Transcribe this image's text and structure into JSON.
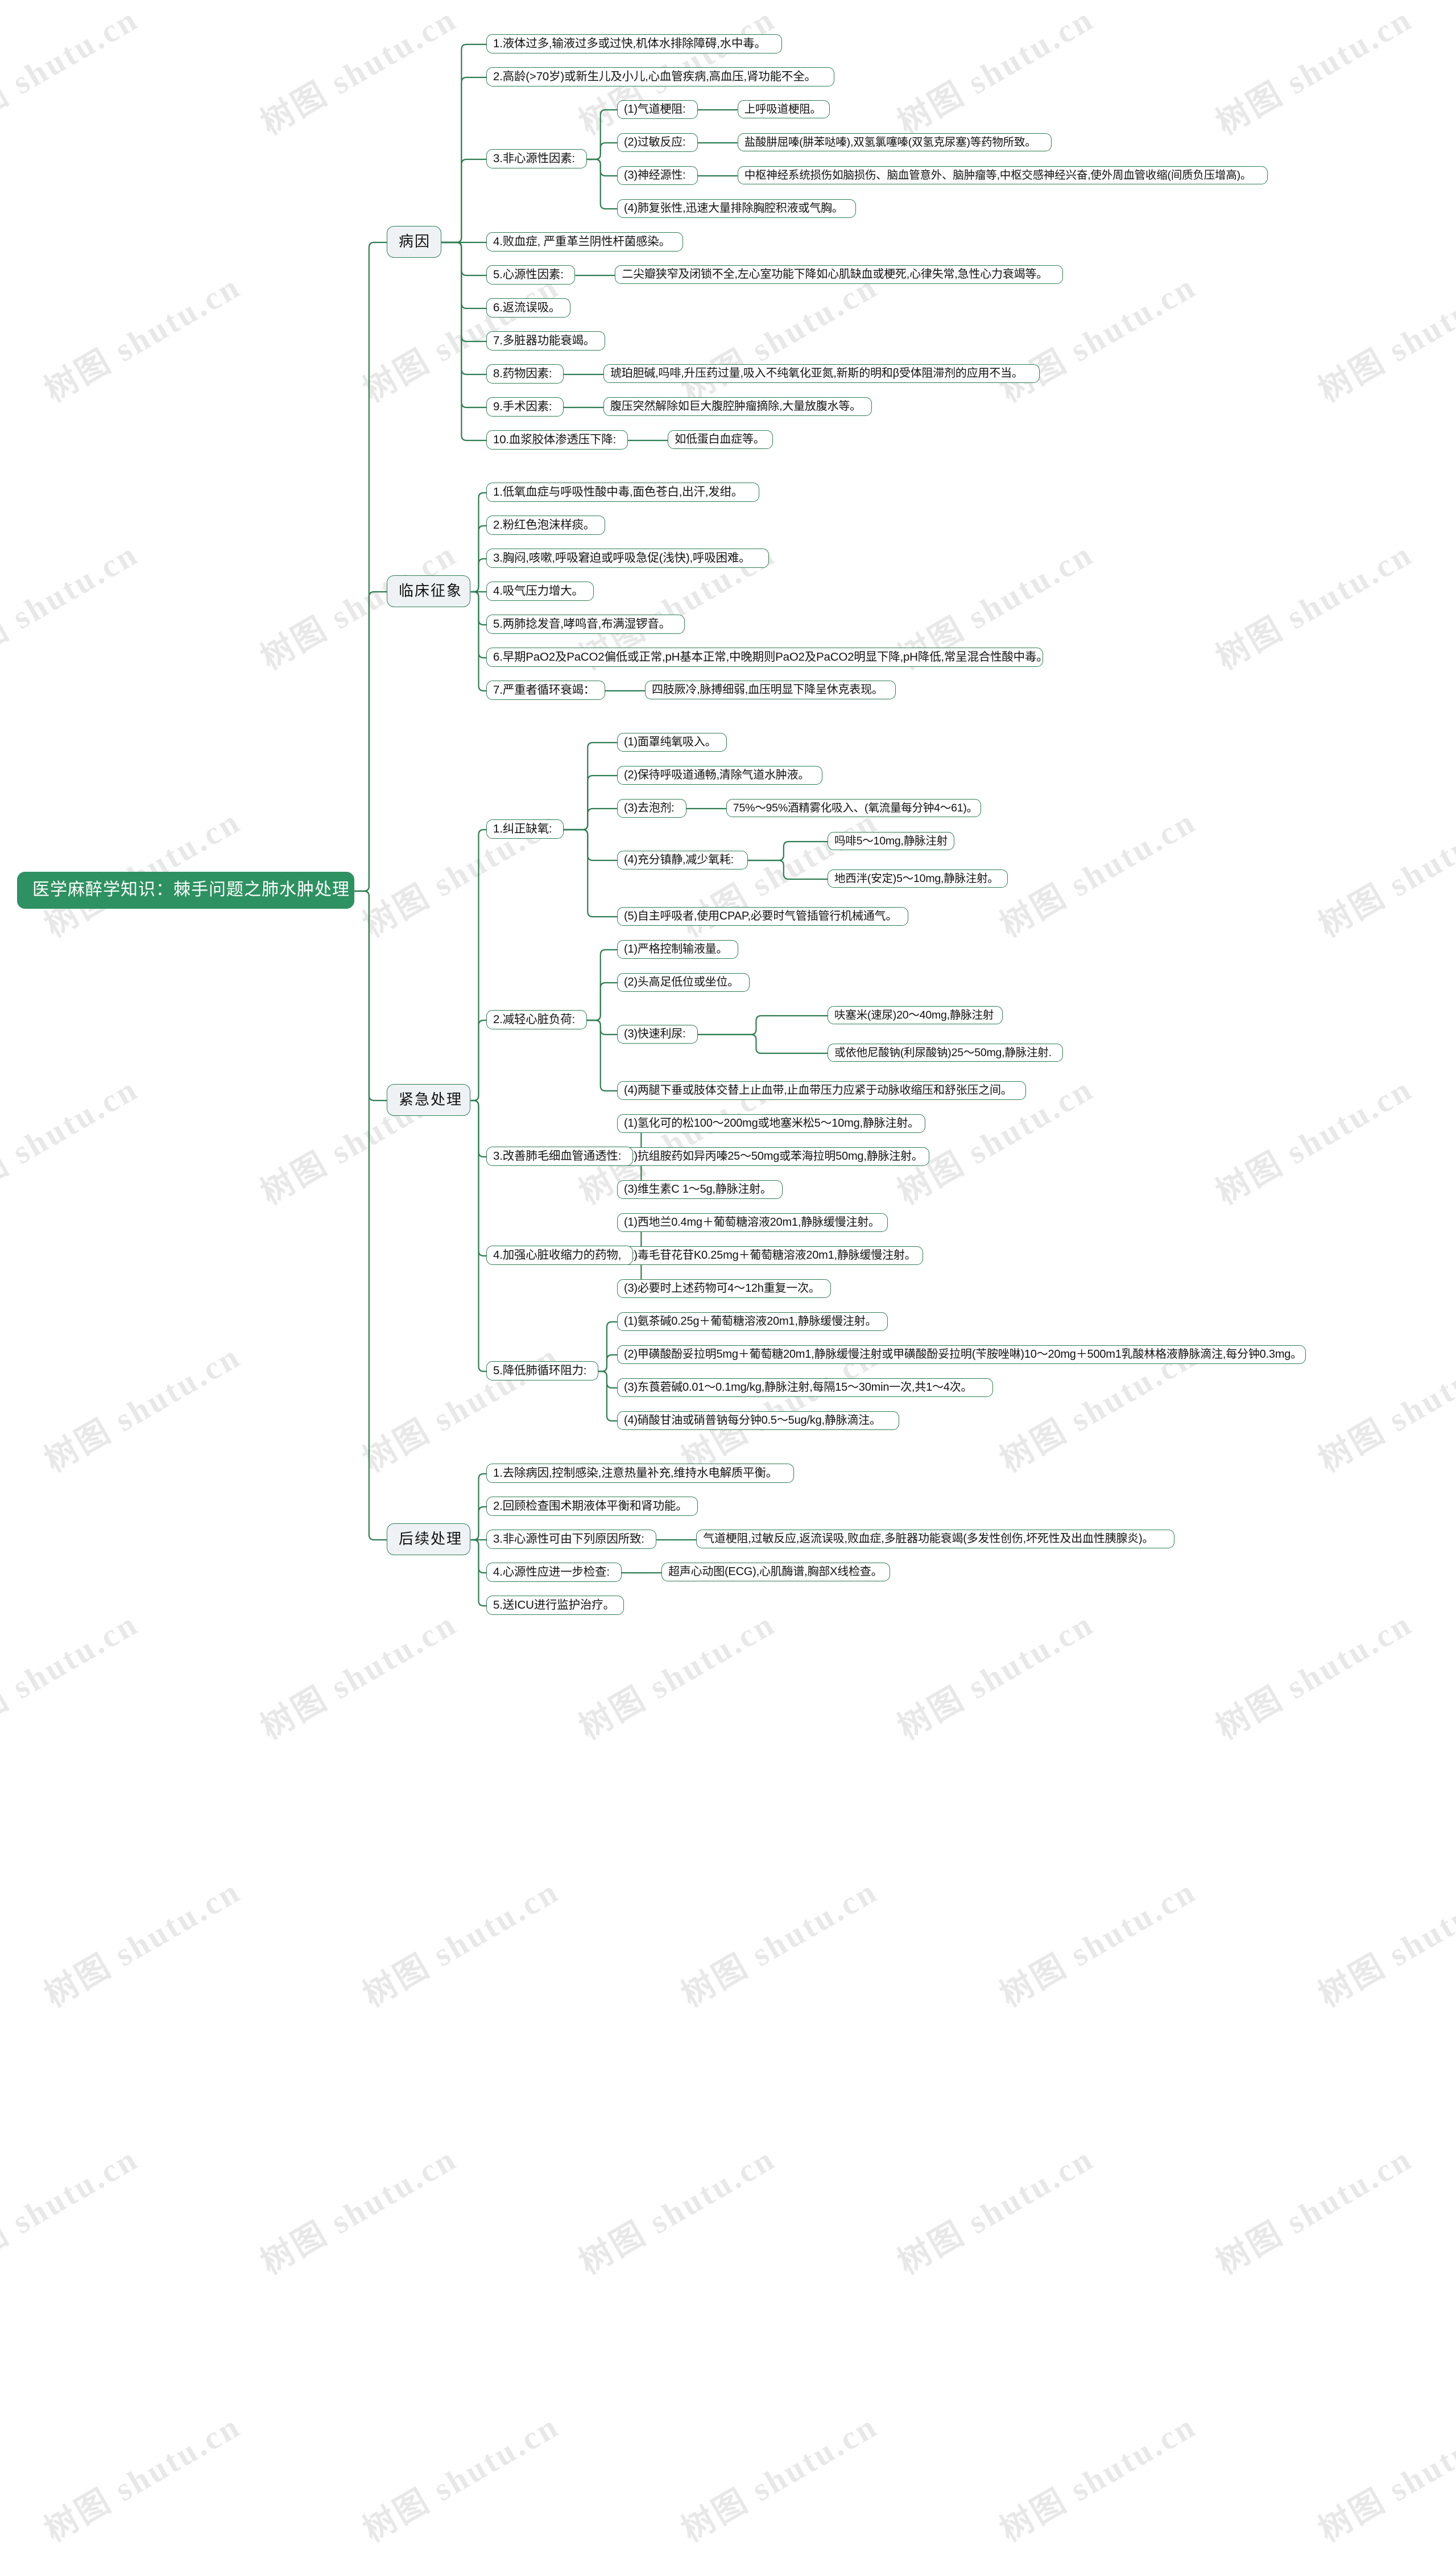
{
  "title": "医学麻醉学知识：棘手问题之肺水肿处理",
  "watermark_texts": [
    "树图 shutu.cn",
    "shutu.cn",
    "树图"
  ],
  "colors": {
    "root_fill": "#2e9161",
    "branch_fill": "#eef2f5",
    "border": "#2e7d53",
    "leaf_fill": "#ffffff",
    "root_text": "#ffffff",
    "body_text": "#111111"
  },
  "root": {
    "label": "医学麻醉学知识：棘手问题之肺水肿处理"
  },
  "branches": [
    {
      "label": "病因",
      "items": [
        {
          "label": "1.液体过多,输液过多或过快,机体水排除障碍,水中毒。"
        },
        {
          "label": "2.高龄(>70岁)或新生儿及小儿,心血管疾病,高血压,肾功能不全。"
        },
        {
          "label": "3.非心源性因素:",
          "children": [
            {
              "label": "(1)气道梗阻:",
              "detail": "上呼吸道梗阻。"
            },
            {
              "label": "(2)过敏反应:",
              "detail": "盐酸肼屈嗪(肼苯哒嗪),双氢氯噻嗪(双氢克尿塞)等药物所致。"
            },
            {
              "label": "(3)神经源性:",
              "detail": "中枢神经系统损伤如脑损伤、脑血管意外、脑肿瘤等,中枢交感神经兴奋,使外周血管收缩(间质负压增高)。"
            },
            {
              "label": "(4)肺复张性,迅速大量排除胸腔积液或气胸。"
            }
          ]
        },
        {
          "label": "4.败血症, 严重革兰阴性杆菌感染。"
        },
        {
          "label": "5.心源性因素:",
          "detail": "二尖瓣狭窄及闭锁不全,左心室功能下降如心肌缺血或梗死,心律失常,急性心力衰竭等。"
        },
        {
          "label": "6.返流误吸。"
        },
        {
          "label": "7.多脏器功能衰竭。"
        },
        {
          "label": "8.药物因素:",
          "detail": "琥珀胆碱,吗啡,升压药过量,吸入不纯氧化亚氮,新斯的明和β受体阻滞剂的应用不当。"
        },
        {
          "label": "9.手术因素:",
          "detail": "腹压突然解除如巨大腹腔肿瘤摘除,大量放腹水等。"
        },
        {
          "label": "10.血浆胶体渗透压下降:",
          "detail": "如低蛋白血症等。"
        }
      ]
    },
    {
      "label": "临床征象",
      "items": [
        {
          "label": "1.低氧血症与呼吸性酸中毒,面色苍白,出汗,发绀。"
        },
        {
          "label": "2.粉红色泡沫样痰。"
        },
        {
          "label": "3.胸闷,咳嗽,呼吸窘迫或呼吸急促(浅快),呼吸困难。"
        },
        {
          "label": "4.吸气压力增大。"
        },
        {
          "label": "5.两肺捻发音,哮鸣音,布满湿锣音。"
        },
        {
          "label": "6.早期PaO2及PaCO2偏低或正常,pH基本正常,中晚期则PaO2及PaCO2明显下降,pH降低,常呈混合性酸中毒。"
        },
        {
          "label": "7.严重者循环衰竭：",
          "detail": "四肢厥冷,脉搏细弱,血压明显下降呈休克表现。"
        }
      ]
    },
    {
      "label": "紧急处理",
      "items": [
        {
          "label": "1.纠正缺氧:",
          "children": [
            {
              "label": "(1)面罩纯氧吸入。"
            },
            {
              "label": "(2)保待呼吸道通畅,清除气道水肿液。"
            },
            {
              "label": "(3)去泡剂:",
              "detail": "75%～95%酒精雾化吸入、(氧流量每分钟4～61)。"
            },
            {
              "label": "(4)充分镇静,减少氧耗:",
              "grandchildren": [
                "吗啡5～10mg,静脉注射",
                "地西泮(安定)5～10mg,静脉注射。"
              ]
            },
            {
              "label": "(5)自主呼吸者,使用CPAP,必要时气管插管行机械通气。"
            }
          ]
        },
        {
          "label": "2.减轻心脏负荷:",
          "children": [
            {
              "label": "(1)严格控制输液量。"
            },
            {
              "label": "(2)头高足低位或坐位。"
            },
            {
              "label": "(3)快速利尿:",
              "grandchildren": [
                "呋塞米(速尿)20～40mg,静脉注射",
                "或依他尼酸钠(利尿酸钠)25～50mg,静脉注射."
              ]
            },
            {
              "label": "(4)两腿下垂或肢体交替上止血带,止血带压力应紧于动脉收缩压和舒张压之间。"
            }
          ]
        },
        {
          "label": "3.改善肺毛细血管通透性:",
          "children": [
            {
              "label": "(1)氢化可的松100～200mg或地塞米松5～10mg,静脉注射。"
            },
            {
              "label": "(2)抗组胺药如异丙嗪25～50mg或苯海拉明50mg,静脉注射。"
            },
            {
              "label": "(3)维生素C 1～5g,静脉注射。"
            }
          ]
        },
        {
          "label": "4.加强心脏收缩力的药物,",
          "children": [
            {
              "label": "(1)西地兰0.4mg＋葡萄糖溶液20m1,静脉缓慢注射。"
            },
            {
              "label": "(2)毒毛苷花苷K0.25mg＋葡萄糖溶液20m1,静脉缓慢注射。"
            },
            {
              "label": "(3)必要时上述药物可4～12h重复一次。"
            }
          ]
        },
        {
          "label": "5.降低肺循环阻力:",
          "children": [
            {
              "label": "(1)氨茶碱0.25g＋葡萄糖溶液20m1,静脉缓慢注射。"
            },
            {
              "label": "(2)甲磺酸酚妥拉明5mg＋葡萄糖20m1,静脉缓慢注射或甲磺酸酚妥拉明(苄胺唑啉)10～20mg＋500m1乳酸林格液静脉滴注,每分钟0.3mg。"
            },
            {
              "label": "(3)东莨菪碱0.01～0.1mg/kg,静脉注射,每隔15～30min一次,共1～4次。"
            },
            {
              "label": "(4)硝酸甘油或硝普钠每分钟0.5～5ug/kg,静脉滴注。"
            }
          ]
        }
      ]
    },
    {
      "label": "后续处理",
      "items": [
        {
          "label": "1.去除病因,控制感染,注意热量补充,维持水电解质平衡。"
        },
        {
          "label": "2.回顾检查围术期液体平衡和肾功能。"
        },
        {
          "label": "3.非心源性可由下列原因所致:",
          "detail": "气道梗阻,过敏反应,返流误吸,败血症,多脏器功能衰竭(多发性创伤,坏死性及出血性胰腺炎)。"
        },
        {
          "label": "4.心源性应进一步检查:",
          "detail": "超声心动图(ECG),心肌酶谱,胸部X线检查。"
        },
        {
          "label": "5.送ICU进行监护治疗。"
        }
      ]
    }
  ]
}
